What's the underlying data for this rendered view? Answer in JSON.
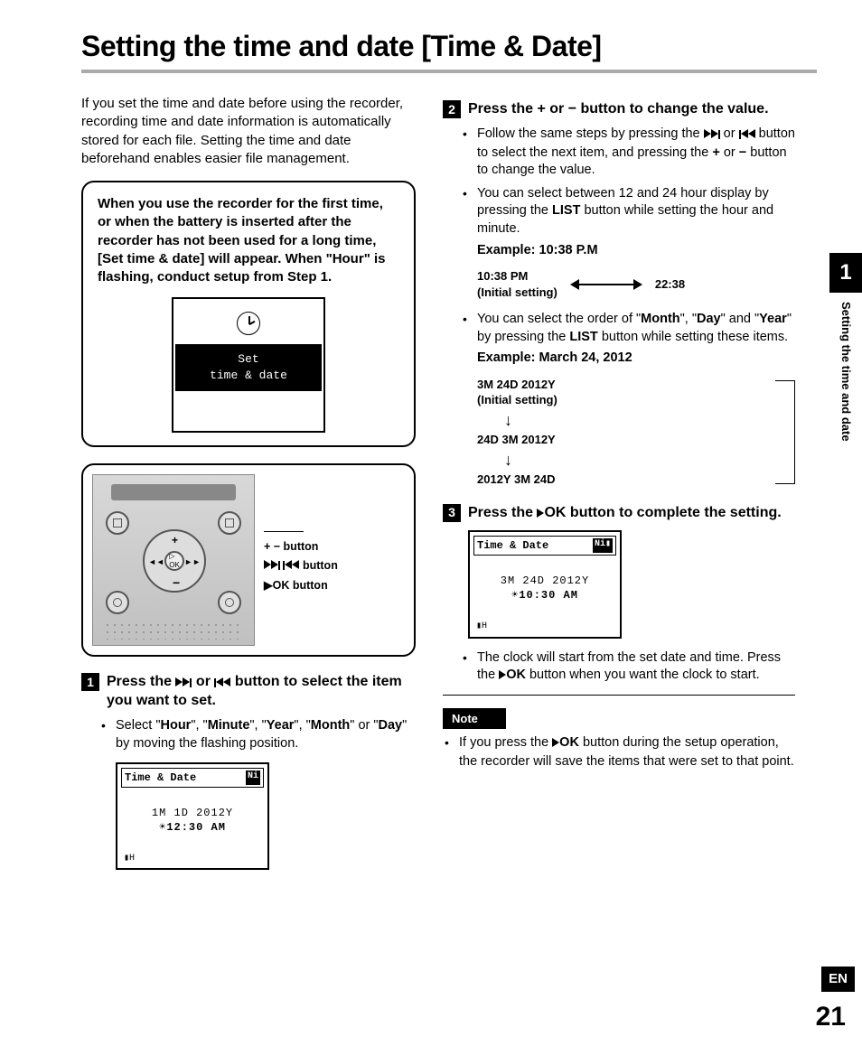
{
  "title": "Setting the time and date [Time & Date]",
  "intro": "If you set the time and date before using the recorder, recording time and date information is automatically stored for each file. Setting the time and date beforehand enables easier file management.",
  "first_time_box": {
    "pre": "When you use the recorder for the first time, or when the battery is inserted after the recorder has not been used for a long time, [",
    "set": "Set time & date",
    "mid": "] will appear. When \"",
    "hour": "Hour",
    "post": "\" is flashing, conduct setup from Step 1.",
    "screen_line1": "Set",
    "screen_line2": "time & date"
  },
  "device_labels": {
    "l1": "+ − button",
    "l2_suffix": " button",
    "l3_prefix": "▶OK button"
  },
  "step1": {
    "num": "1",
    "text_pre": "Press the ",
    "text_mid": " or ",
    "text_post": " button to select the item you want to set.",
    "bullet": "Select \"Hour\", \"Minute\", \"Year\", \"Month\" or \"Day\" by moving the flashing position.",
    "b_hour": "Hour",
    "b_min": "Minute",
    "b_year": "Year",
    "b_month": "Month",
    "b_day": "Day",
    "lcd_title": "Time & Date",
    "lcd_batt": "Ni",
    "lcd_line1": "1M 1D  2012Y",
    "lcd_line2": "12:30 AM"
  },
  "step2": {
    "num": "2",
    "text": "Press the + or − button to change the value.",
    "bullet1_pre": "Follow the same steps by pressing the ",
    "bullet1_mid": " or ",
    "bullet1_post": " button to select the next item, and pressing the + or − button to change the value.",
    "bullet2_pre": "You can select between 12 and 24 hour display by pressing the ",
    "bullet2_list": "LIST",
    "bullet2_post": " button while setting the hour and minute.",
    "example1_label": "Example: 10:38 P.M",
    "ex1_left_a": "10:38 PM",
    "ex1_left_b": "(Initial setting)",
    "ex1_right": "22:38",
    "bullet3_pre": "You can select the order of \"",
    "bullet3_m": "Month",
    "bullet3_d": "Day",
    "bullet3_y": "Year",
    "bullet3_mid1": "\", \"",
    "bullet3_mid2": "\" and \"",
    "bullet3_post": "\" by pressing the LIST button while setting these items.",
    "b3_list": "LIST",
    "example2_label": "Example: March 24, 2012",
    "df_r1": "3M 24D 2012Y",
    "df_r1b": "(Initial setting)",
    "df_r2": "24D 3M 2012Y",
    "df_r3": "2012Y 3M 24D"
  },
  "step3": {
    "num": "3",
    "text_pre": "Press the ",
    "text_ok": "▶OK",
    "text_post": " button to complete the setting.",
    "lcd_title": "Time & Date",
    "lcd_line1": "3M 24D  2012Y",
    "lcd_line2": "10:30 AM",
    "bullet_pre": "The clock will start from the set date and time. Press the ",
    "bullet_ok": "▶OK",
    "bullet_post": " button when you want the clock to start."
  },
  "note": {
    "label": "Note",
    "text_pre": "If you press the ",
    "text_ok": "▶OK",
    "text_post": " button during the setup operation, the recorder will save the items that were set to that point."
  },
  "side": {
    "chapter": "1",
    "label": "Setting the time and date"
  },
  "lang": "EN",
  "page": "21"
}
